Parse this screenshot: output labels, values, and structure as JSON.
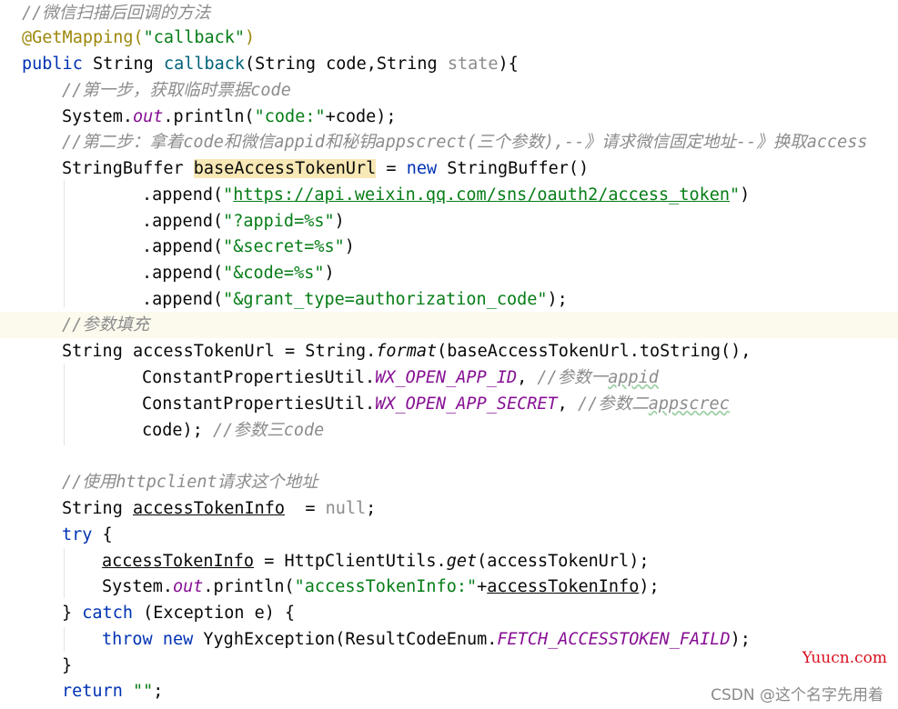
{
  "code": {
    "l01": {
      "comment": "//微信扫描后回调的方法"
    },
    "l02": {
      "annotation": "@GetMapping(",
      "path": "\"callback\"",
      "close": ")"
    },
    "l03": {
      "public_kw": "public",
      "t1": " String ",
      "method": "callback",
      "t2": "(String code,String ",
      "param_state": "state",
      "t3": "){"
    },
    "l04": {
      "comment": "//第一步，获取临时票据code"
    },
    "l05": {
      "t1": "System.",
      "out": "out",
      "t2": ".println(",
      "str": "\"code:\"",
      "t3": "+code);"
    },
    "l06": {
      "comment": "//第二步：拿着code和微信appid和秘钥appscrect(三个参数),--》请求微信固定地址--》换取access"
    },
    "l07": {
      "t1": "StringBuffer ",
      "var": "baseAccessTokenUrl",
      "t2": " = ",
      "new_kw": "new",
      "t3": " StringBuffer()"
    },
    "l08": {
      "t1": ".append(",
      "q1": "\"",
      "url": "https://api.weixin.qq.com/sns/oauth2/access_token",
      "q2": "\"",
      "t2": ")"
    },
    "l09": {
      "t1": ".append(",
      "str": "\"?appid=%s\"",
      "t2": ")"
    },
    "l10": {
      "t1": ".append(",
      "str": "\"&secret=%s\"",
      "t2": ")"
    },
    "l11": {
      "t1": ".append(",
      "str": "\"&code=%s\"",
      "t2": ")"
    },
    "l12": {
      "t1": ".append(",
      "str": "\"&grant_type=authorization_code\"",
      "t2": ");"
    },
    "l13": {
      "comment": "//参数填充"
    },
    "l14": {
      "t1": "String accessTokenUrl = String.",
      "format": "format",
      "t2": "(baseAccessTokenUrl.toString(),"
    },
    "l15": {
      "t1": "ConstantPropertiesUtil.",
      "field": "WX_OPEN_APP_ID",
      "t2": ", ",
      "comment_a": "//参数一",
      "comment_b": "appid"
    },
    "l16": {
      "t1": "ConstantPropertiesUtil.",
      "field": "WX_OPEN_APP_SECRET",
      "t2": ", ",
      "comment_a": "//参数二",
      "comment_b": "appscrec"
    },
    "l17": {
      "t1": "code); ",
      "comment": "//参数三code"
    },
    "l19": {
      "comment": "//使用httpclient请求这个地址"
    },
    "l20": {
      "t1": "String ",
      "var": "accessTokenInfo",
      "t2": "  = ",
      "null_kw": "null",
      "t3": ";"
    },
    "l21": {
      "try_kw": "try",
      "t1": " {"
    },
    "l22": {
      "var": "accessTokenInfo",
      "t1": " = HttpClientUtils.",
      "get": "get",
      "t2": "(accessTokenUrl);"
    },
    "l23": {
      "t1": "System.",
      "out": "out",
      "t2": ".println(",
      "str": "\"accessTokenInfo:\"",
      "t3": "+",
      "var": "accessTokenInfo",
      "t4": ");"
    },
    "l24": {
      "t1": "} ",
      "catch_kw": "catch",
      "t2": " (Exception e) {"
    },
    "l25": {
      "throw_kw": "throw",
      "t1": " ",
      "new_kw": "new",
      "t2": " YyghException(ResultCodeEnum.",
      "field": "FETCH_ACCESSTOKEN_FAILD",
      "t3": ");"
    },
    "l26": {
      "t1": "}"
    },
    "l27": {
      "return_kw": "return",
      "t1": " ",
      "str": "\"\"",
      "t2": ";"
    }
  },
  "watermarks": {
    "site": "Yuucn.com",
    "author": "CSDN @这个名字先用着"
  },
  "icons": {
    "gutter": "intention-bulb-icon"
  },
  "colors": {
    "keyword": "#0033b3",
    "string": "#067d17",
    "comment": "#8c8c8c",
    "annotation": "#9e880d",
    "method": "#00627a",
    "field": "#871094",
    "highlight_line": "#fcfaed",
    "site_watermark": "#d80f1e"
  }
}
